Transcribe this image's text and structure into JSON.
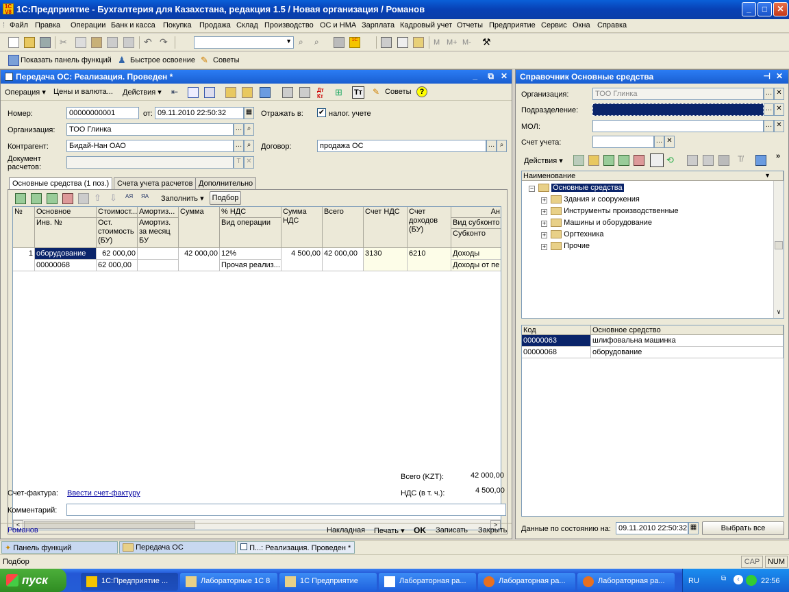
{
  "window": {
    "title": "1С:Предприятие - Бухгалтерия для Казахстана, редакция 1.5 / Новая организация / Романов",
    "logo_text": "1С\nV8"
  },
  "menu": [
    "Файл",
    "Правка",
    "Операции",
    "Банк и касса",
    "Покупка",
    "Продажа",
    "Склад",
    "Производство",
    "ОС и НМА",
    "Зарплата",
    "Кадровый учет",
    "Отчеты",
    "Предприятие",
    "Сервис",
    "Окна",
    "Справка"
  ],
  "toolbar3": {
    "show_panel": "Показать панель функций",
    "quick": "Быстрое освоение",
    "tips": "Советы"
  },
  "doc": {
    "title": "Передача ОС: Реализация. Проведен *",
    "toolbar": {
      "operation": "Операция",
      "prices": "Цены и валюта...",
      "actions": "Действия",
      "tips": "Советы"
    },
    "fields": {
      "number_label": "Номер:",
      "number": "00000000001",
      "from_label": "от:",
      "date": "09.11.2010 22:50:32",
      "reflect_label": "Отражать в:",
      "tax_label": "налог. учете",
      "org_label": "Организация:",
      "org": "ТОО Глинка",
      "contractor_label": "Контрагент:",
      "contractor": "Бидай-Нан ОАО",
      "contract_label": "Договор:",
      "contract": "продажа ОС",
      "doc_label": "Документ расчетов:",
      "doc_value": ""
    },
    "tabs": [
      "Основные средства (1 поз.)",
      "Счета учета расчетов",
      "Дополнительно"
    ],
    "table_toolbar": {
      "fill": "Заполнить",
      "pick": "Подбор"
    },
    "headers_top": [
      "№",
      "Основное сред...",
      "Стоимост...",
      "Амортиз...",
      "Сумма",
      "% НДС",
      "Сумма НДС",
      "Всего",
      "Счет НДС",
      "Счет доходов (БУ)",
      "Ан"
    ],
    "headers_bottom": [
      "",
      "Инв. №",
      "Ост. стоимость (БУ)",
      "Амортиз. за месяц БУ",
      "",
      "Вид операции",
      "",
      "",
      "",
      "",
      "Вид субконто"
    ],
    "headers_sub": "Субконто",
    "row1": [
      "1",
      "оборудование",
      "62 000,00",
      "",
      "42 000,00",
      "12%",
      "4 500,00",
      "42 000,00",
      "3130",
      "6210",
      "Доходы"
    ],
    "row2": [
      "",
      "00000068",
      "62 000,00",
      "",
      "",
      "Прочая реализ...",
      "",
      "",
      "",
      "",
      "Доходы от пе"
    ],
    "totals": {
      "total_label": "Всего (KZT):",
      "total": "42 000,00",
      "vat_label": "НДС (в т. ч.):",
      "vat": "4 500,00"
    },
    "invoice_label": "Счет-фактура:",
    "invoice_link": "Ввести счет-фактуру",
    "comment_label": "Комментарий:",
    "comment": "",
    "footer": {
      "user": "Романов",
      "invoice": "Накладная",
      "print": "Печать",
      "ok": "OK",
      "save": "Записать",
      "close": "Закрыть"
    }
  },
  "ref": {
    "title": "Справочник Основные средства",
    "org_label": "Организация:",
    "org": "ТОО Глинка",
    "dept_label": "Подразделение:",
    "dept": "",
    "mol_label": "МОЛ:",
    "mol": "",
    "acct_label": "Счет учета:",
    "acct": "",
    "actions": "Действия",
    "tree_header": "Наименование",
    "tree_root": "Основные средства",
    "tree_items": [
      "Здания и сооружения",
      "Инструменты производственные",
      "Машины и оборудование",
      "Оргтехника",
      "Прочие"
    ],
    "list_headers": [
      "Код",
      "Основное средство"
    ],
    "list_rows": [
      [
        "00000063",
        "шлифовальна машинка"
      ],
      [
        "00000068",
        "оборудование"
      ]
    ],
    "state_label": "Данные по состоянию на:",
    "state_date": "09.11.2010 22:50:32",
    "select_all": "Выбрать все"
  },
  "windows_bar": [
    "Панель функций",
    "Передача ОС",
    "П...: Реализация. Проведен *"
  ],
  "status": {
    "text": "Подбор",
    "cap": "CAP",
    "num": "NUM"
  },
  "taskbar": {
    "start": "пуск",
    "items": [
      "1С:Предприятие ...",
      "Лабораторные 1С 8",
      "1С Предприятие",
      "Лабораторная ра...",
      "Лабораторная ра...",
      "Лабораторная ра..."
    ],
    "lang": "RU",
    "clock": "22:56"
  },
  "colors": {
    "title_bg": "#0a5fd8",
    "selection": "#0a246a",
    "link": "#0000a0"
  }
}
